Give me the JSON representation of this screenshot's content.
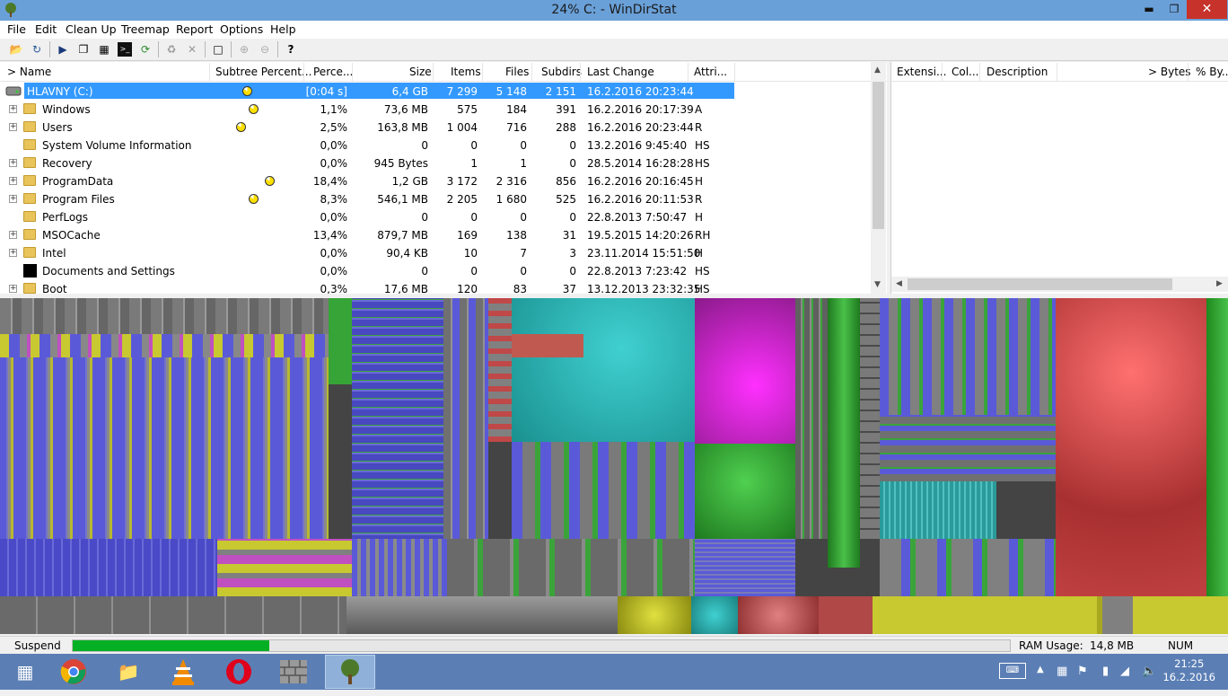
{
  "window": {
    "title": "24% C: - WinDirStat",
    "app_icon": "tree-icon",
    "minimize_icon": "minimize-icon",
    "maximize_icon": "restore-icon",
    "close_icon": "close-icon"
  },
  "menu": [
    "File",
    "Edit",
    "Clean Up",
    "Treemap",
    "Report",
    "Options",
    "Help"
  ],
  "toolbar_icons": [
    "open-icon",
    "refresh-all-icon",
    "play-icon",
    "copy-icon",
    "explorer-icon",
    "cmd-icon",
    "refresh-icon",
    "recycle-icon",
    "delete-icon",
    "properties-icon",
    "zoom-in-icon",
    "zoom-out-icon",
    "help-icon"
  ],
  "tree": {
    "columns": [
      "> Name",
      "Subtree Percent...",
      "Perce...",
      "Size",
      "Items",
      "Files",
      "Subdirs",
      "Last Change",
      "Attri..."
    ],
    "rows": [
      {
        "name": "HLAVNY (C:)",
        "pct": "[0:04 s]",
        "size": "6,4 GB",
        "items": "7 299",
        "files": "5 148",
        "subdirs": "2 151",
        "date": "16.2.2016  20:23:44",
        "attr": "",
        "selected": true
      },
      {
        "name": "Windows",
        "pct": "1,1%",
        "size": "73,6 MB",
        "items": "575",
        "files": "184",
        "subdirs": "391",
        "date": "16.2.2016  20:17:39",
        "attr": "A"
      },
      {
        "name": "Users",
        "pct": "2,5%",
        "size": "163,8 MB",
        "items": "1 004",
        "files": "716",
        "subdirs": "288",
        "date": "16.2.2016  20:23:44",
        "attr": "R"
      },
      {
        "name": "System Volume Information",
        "pct": "0,0%",
        "size": "0",
        "items": "0",
        "files": "0",
        "subdirs": "0",
        "date": "13.2.2016  9:45:40",
        "attr": "HS"
      },
      {
        "name": "Recovery",
        "pct": "0,0%",
        "size": "945 Bytes",
        "items": "1",
        "files": "1",
        "subdirs": "0",
        "date": "28.5.2014  16:28:28",
        "attr": "HS"
      },
      {
        "name": "ProgramData",
        "pct": "18,4%",
        "size": "1,2 GB",
        "items": "3 172",
        "files": "2 316",
        "subdirs": "856",
        "date": "16.2.2016  20:16:45",
        "attr": "H"
      },
      {
        "name": "Program Files",
        "pct": "8,3%",
        "size": "546,1 MB",
        "items": "2 205",
        "files": "1 680",
        "subdirs": "525",
        "date": "16.2.2016  20:11:53",
        "attr": "R"
      },
      {
        "name": "PerfLogs",
        "pct": "0,0%",
        "size": "0",
        "items": "0",
        "files": "0",
        "subdirs": "0",
        "date": "22.8.2013  7:50:47",
        "attr": "H"
      },
      {
        "name": "MSOCache",
        "pct": "13,4%",
        "size": "879,7 MB",
        "items": "169",
        "files": "138",
        "subdirs": "31",
        "date": "19.5.2015  14:20:26",
        "attr": "RH"
      },
      {
        "name": "Intel",
        "pct": "0,0%",
        "size": "90,4 KB",
        "items": "10",
        "files": "7",
        "subdirs": "3",
        "date": "23.11.2014  15:51:50",
        "attr": "H"
      },
      {
        "name": "Documents and Settings",
        "pct": "0,0%",
        "size": "0",
        "items": "0",
        "files": "0",
        "subdirs": "0",
        "date": "22.8.2013  7:23:42",
        "attr": "HS"
      },
      {
        "name": "Boot",
        "pct": "0,3%",
        "size": "17,6 MB",
        "items": "120",
        "files": "83",
        "subdirs": "37",
        "date": "13.12.2013  23:32:35",
        "attr": "HS"
      }
    ]
  },
  "ext": {
    "columns": [
      "Extensi...",
      "Col...",
      "Description",
      "> Bytes",
      "% By..."
    ]
  },
  "status": {
    "suspend": "Suspend",
    "progress": 0.21,
    "ram_label": "RAM Usage:",
    "ram_value": "14,8 MB",
    "num": "NUM"
  },
  "taskbar": {
    "apps": [
      "windows-start-icon",
      "chrome-icon",
      "file-explorer-icon",
      "vlc-icon",
      "opera-icon",
      "wall-icon",
      "windirstat-icon"
    ],
    "time": "21:25",
    "date": "16.2.2016"
  },
  "colors": {
    "titlebar": "#6aa0d8",
    "selection": "#3399ff",
    "progress": "#06b025",
    "taskbar": "#5b7fb5"
  }
}
